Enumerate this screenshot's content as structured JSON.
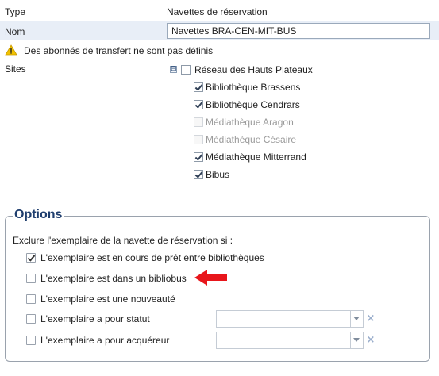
{
  "form": {
    "type_label": "Type",
    "type_value": "Navettes de réservation",
    "name_label": "Nom",
    "name_value": "Navettes BRA-CEN-MIT-BUS",
    "warning_text": "Des abonnés de transfert ne sont pas définis",
    "sites_label": "Sites"
  },
  "sites_tree": {
    "toggle_symbol": "⊟",
    "root": {
      "label": "Réseau des Hauts Plateaux",
      "checked": false
    },
    "children": [
      {
        "label": "Bibliothèque Brassens",
        "checked": true,
        "disabled": false
      },
      {
        "label": "Bibliothèque Cendrars",
        "checked": true,
        "disabled": false
      },
      {
        "label": "Médiathèque Aragon",
        "checked": false,
        "disabled": true
      },
      {
        "label": "Médiathèque Césaire",
        "checked": false,
        "disabled": true
      },
      {
        "label": "Médiathèque Mitterrand",
        "checked": true,
        "disabled": false
      },
      {
        "label": "Bibus",
        "checked": true,
        "disabled": false
      }
    ]
  },
  "options": {
    "legend": "Options",
    "intro": "Exclure l'exemplaire de la navette de réservation si :",
    "items": [
      {
        "label": "L'exemplaire est en cours de prêt entre bibliothèques",
        "checked": true
      },
      {
        "label": "L'exemplaire est dans un bibliobus",
        "checked": false
      },
      {
        "label": "L'exemplaire est une nouveauté",
        "checked": false
      },
      {
        "label": "L'exemplaire a pour statut",
        "checked": false,
        "combo_value": ""
      },
      {
        "label": "L'exemplaire a pour acquéreur",
        "checked": false,
        "combo_value": ""
      }
    ],
    "clear_symbol": "×"
  },
  "colors": {
    "accent": "#1f3e6e",
    "highlight_row": "#e8eef7",
    "annotation_arrow": "#e8161b",
    "warning": "#f2c200"
  }
}
